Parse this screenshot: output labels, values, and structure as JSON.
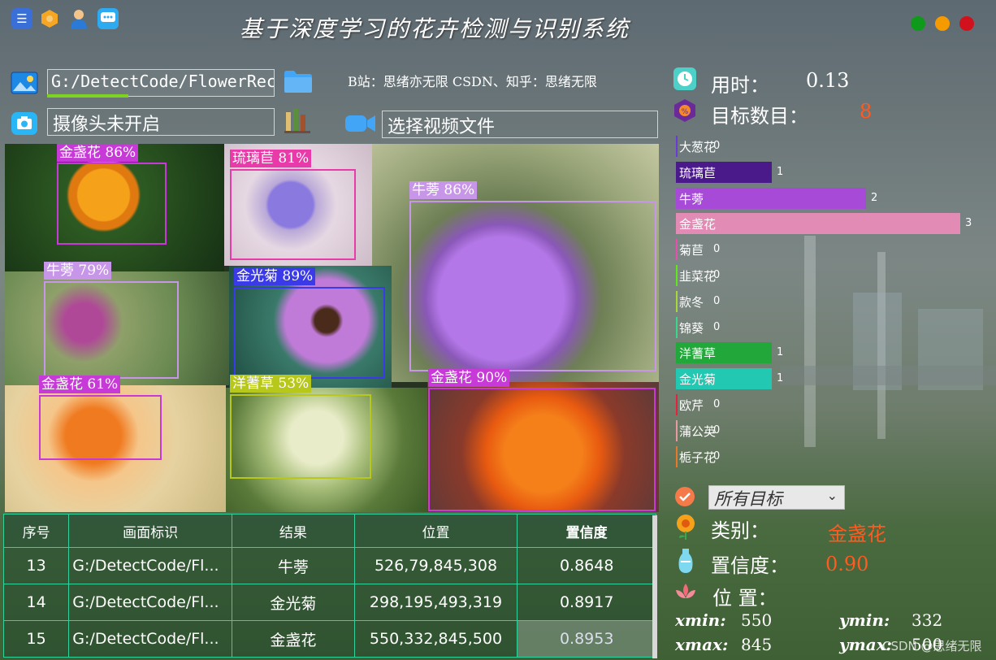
{
  "window": {
    "title": "基于深度学习的花卉检测与识别系统",
    "buttons_colors": {
      "green": "#0f9a1c",
      "orange": "#f59b00",
      "red": "#d1121c"
    }
  },
  "topbar_icons": [
    "menu-icon",
    "hexagon-icon",
    "user-icon",
    "chat-icon"
  ],
  "source": {
    "image_path": "G:/DetectCode/FlowerRec",
    "camera_status": "摄像头未开启",
    "video_placeholder": "选择视频文件",
    "credits": "B站：思绪亦无限  CSDN、知乎：思绪无限"
  },
  "stats": {
    "time_label": "用时：",
    "time_value": "0.13",
    "count_label": "目标数目：",
    "count_value": "8"
  },
  "chart_data": {
    "type": "bar",
    "orientation": "horizontal",
    "categories": [
      "大葱花",
      "琉璃苣",
      "牛蒡",
      "金盏花",
      "菊苣",
      "韭菜花",
      "款冬",
      "锦葵",
      "洋蓍草",
      "金光菊",
      "欧芹",
      "蒲公英",
      "栀子花"
    ],
    "values": [
      0,
      1,
      2,
      3,
      0,
      0,
      0,
      0,
      1,
      1,
      0,
      0,
      0
    ],
    "colors": [
      "#6a3ad6",
      "#4b1a8a",
      "#a84ad8",
      "#e28bb5",
      "#e84db0",
      "#61e81a",
      "#a8d83a",
      "#3ad88a",
      "#22a83a",
      "#22c8b2",
      "#e82040",
      "#e89aa0",
      "#e8782a"
    ],
    "xlim": [
      0,
      3
    ]
  },
  "filter": {
    "selected": "所有目标"
  },
  "details": {
    "class_label": "类别：",
    "class_value": "金盏花",
    "conf_label": "置信度：",
    "conf_value": "0.90",
    "pos_label": "位 置：",
    "xmin_label": "xmin:",
    "xmin": "550",
    "ymin_label": "ymin:",
    "ymin": "332",
    "xmax_label": "xmax:",
    "xmax": "845",
    "ymax_label": "ymax:",
    "ymax": "500"
  },
  "watermark": "CSDN @思绪无限",
  "detections": [
    {
      "label": "金盏花 86%",
      "color": "#c83ad8"
    },
    {
      "label": "琉璃苣 81%",
      "color": "#e83aa8"
    },
    {
      "label": "牛蒡 86%",
      "color": "#c896e8"
    },
    {
      "label": "牛蒡 79%",
      "color": "#c896e8"
    },
    {
      "label": "金光菊 89%",
      "color": "#3a3ae8"
    },
    {
      "label": "金盏花 61%",
      "color": "#c83ad8"
    },
    {
      "label": "洋蓍草 53%",
      "color": "#b8c81a"
    },
    {
      "label": "金盏花 90%",
      "color": "#c83ad8"
    }
  ],
  "table": {
    "headers": [
      "序号",
      "画面标识",
      "结果",
      "位置",
      "置信度"
    ],
    "rows": [
      [
        "13",
        "G:/DetectCode/Fl...",
        "牛蒡",
        "526,79,845,308",
        "0.8648"
      ],
      [
        "14",
        "G:/DetectCode/Fl...",
        "金光菊",
        "298,195,493,319",
        "0.8917"
      ],
      [
        "15",
        "G:/DetectCode/Fl...",
        "金盏花",
        "550,332,845,500",
        "0.8953"
      ]
    ]
  }
}
